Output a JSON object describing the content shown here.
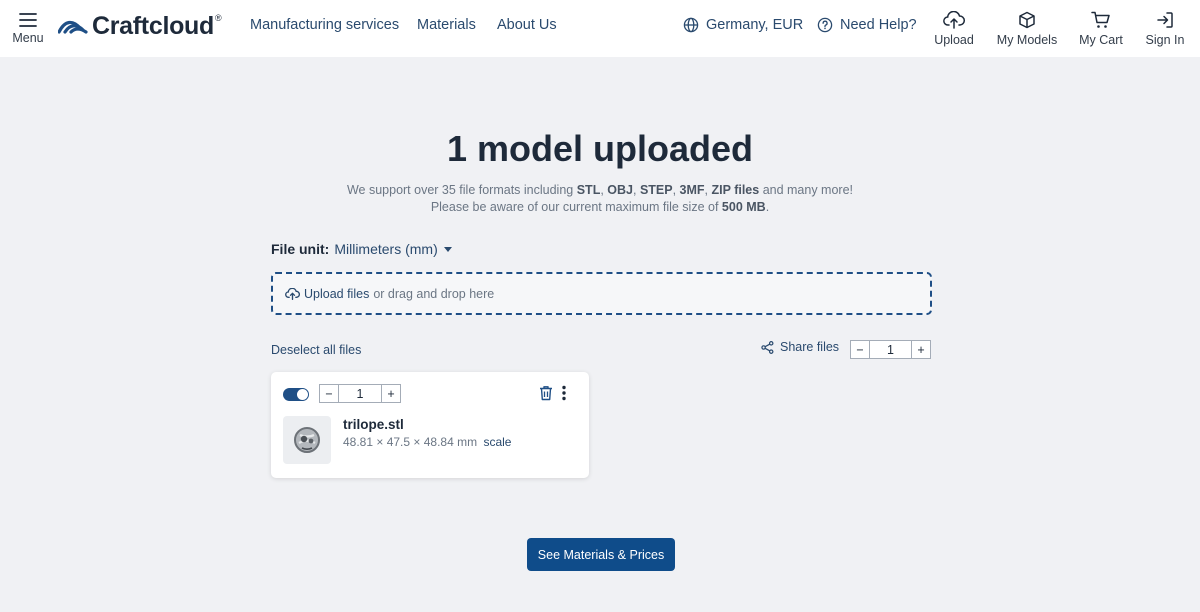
{
  "header": {
    "menu_label": "Menu",
    "logo_text": "Craftcloud",
    "logo_mark": "®",
    "nav": {
      "manufacturing": "Manufacturing services",
      "materials": "Materials",
      "about": "About Us"
    },
    "region": "Germany, EUR",
    "help": "Need Help?",
    "upload_label": "Upload",
    "models_label": "My Models",
    "cart_label": "My Cart",
    "signin_label": "Sign In"
  },
  "main": {
    "title": "1 model uploaded",
    "support": {
      "prefix": "We support over 35 file formats including ",
      "stl": "STL",
      "sep1": ", ",
      "obj": "OBJ",
      "sep2": ", ",
      "step": "STEP",
      "sep3": ", ",
      "threemf": "3MF",
      "sep4": ", ",
      "zip": "ZIP files",
      "suffix": " and many more!"
    },
    "size_note": {
      "prefix": "Please be aware of our current maximum file size of ",
      "size": "500 MB",
      "suffix": "."
    },
    "file_unit_label": "File unit:",
    "file_unit_value": "Millimeters (mm)",
    "dropzone": {
      "upload_link": "Upload files",
      "rest": "or drag and drop here"
    },
    "deselect": "Deselect all files",
    "share": "Share files",
    "global_quantity": "1",
    "minus": "−",
    "plus": "+",
    "file": {
      "quantity": "1",
      "name": "trilope.stl",
      "dimensions": "48.81 × 47.5 × 48.84 mm",
      "scale": "scale",
      "selected": true
    },
    "cta": "See Materials & Prices"
  },
  "colors": {
    "brand": "#0f4c8a",
    "link": "#2a4a6e",
    "background": "#f0f1f4"
  },
  "icons": [
    "menu-icon",
    "logo-icon",
    "globe-icon",
    "help-icon",
    "upload-cloud-icon",
    "cube-icon",
    "cart-icon",
    "sign-in-icon",
    "chevron-down-icon",
    "share-icon",
    "trash-icon",
    "kebab-icon"
  ]
}
